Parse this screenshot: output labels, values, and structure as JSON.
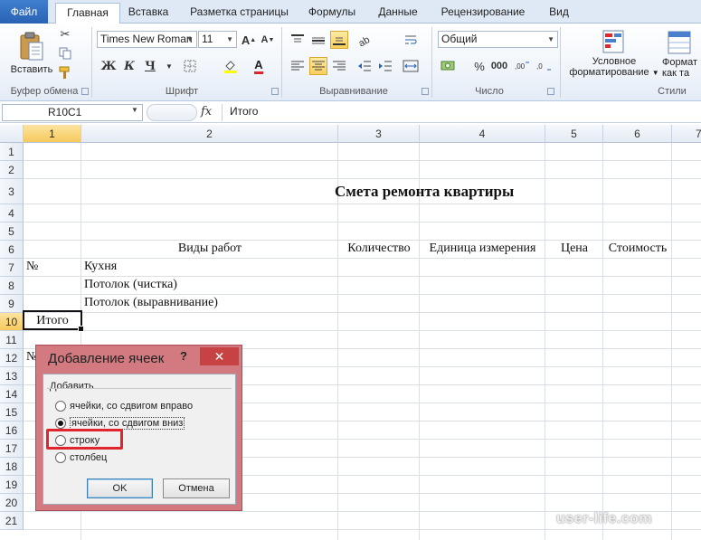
{
  "tabs": [
    "Файл",
    "Главная",
    "Вставка",
    "Разметка страницы",
    "Формулы",
    "Данные",
    "Рецензирование",
    "Вид"
  ],
  "ribbon": {
    "clipboard": {
      "paste_label": "Вставить",
      "group_label": "Буфер обмена"
    },
    "font": {
      "font_name": "Times New Roman",
      "font_size": "11",
      "bold": "Ж",
      "italic": "К",
      "underline": "Ч",
      "group_label": "Шрифт"
    },
    "alignment": {
      "group_label": "Выравнивание"
    },
    "number": {
      "format": "Общий",
      "percent": "%",
      "thousands": "000",
      "group_label": "Число"
    },
    "styles": {
      "conditional_label_1": "Условное",
      "conditional_label_2": "форматирование",
      "format_table_1": "Формат",
      "format_table_2": "как та",
      "group_label": "Стили"
    }
  },
  "formula_bar": {
    "name_box": "R10C1",
    "fx": "fx",
    "value": "Итого"
  },
  "grid": {
    "columns": [
      "1",
      "2",
      "3",
      "4",
      "5",
      "6",
      "7"
    ],
    "rows": [
      "1",
      "2",
      "3",
      "4",
      "5",
      "6",
      "7",
      "8",
      "9",
      "10",
      "11",
      "12",
      "13",
      "14",
      "15",
      "16",
      "17",
      "18",
      "19",
      "20",
      "21"
    ],
    "active_column": "1",
    "active_row": "10"
  },
  "cells": {
    "title": "Смета ремонта квартиры",
    "header_work_types": "Виды работ",
    "header_quantity": "Количество",
    "header_unit": "Единица измерения",
    "header_price": "Цена",
    "header_cost": "Стоимость",
    "r7_c1": "№",
    "r7_c2": "Кухня",
    "r8_c2": "Потолок (чистка)",
    "r9_c2": "Потолок (выравнивание)",
    "r10_c1": "Итого",
    "r12_c1": "№"
  },
  "dialog": {
    "title": "Добавление ячеек",
    "help": "?",
    "close": "✕",
    "group_label": "Добавить",
    "options": [
      {
        "label": "ячейки, со сдвигом вправо",
        "checked": false
      },
      {
        "label": "ячейки, со сдвигом вниз",
        "checked": true
      },
      {
        "label": "строку",
        "checked": false
      },
      {
        "label": "столбец",
        "checked": false
      }
    ],
    "ok_label": "OK",
    "cancel_label": "Отмена"
  },
  "watermark": "user-life.com",
  "colors": {
    "accent": "#2a62b4",
    "highlight_red": "#e0262c",
    "active_header": "#f6c95c"
  }
}
